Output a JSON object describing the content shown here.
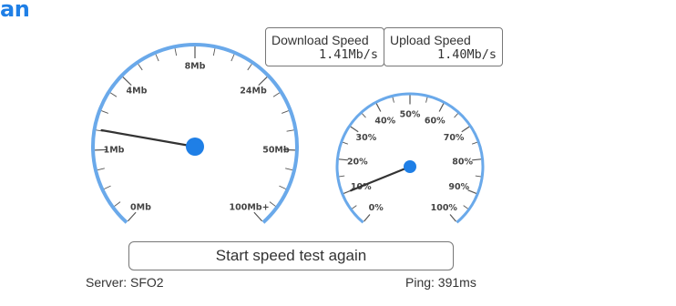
{
  "logo": {
    "text": "an",
    "color": "#1f7fe6"
  },
  "download": {
    "label": "Download Speed",
    "value": "1.41Mb/s"
  },
  "upload": {
    "label": "Upload Speed",
    "value": "1.40Mb/s"
  },
  "speed_gauge": {
    "labels": [
      "0Mb",
      "1Mb",
      "4Mb",
      "8Mb",
      "24Mb",
      "50Mb",
      "100Mb+"
    ],
    "needle_fraction": 0.21,
    "arc_color": "#6aa9ea",
    "hub_color": "#1f7fe6",
    "needle_color": "#333333"
  },
  "progress_gauge": {
    "labels": [
      "0%",
      "10%",
      "20%",
      "30%",
      "40%",
      "50%",
      "60%",
      "70%",
      "80%",
      "90%",
      "100%"
    ],
    "needle_fraction": 0.1,
    "arc_color": "#6aa9ea",
    "hub_color": "#1f7fe6",
    "needle_color": "#333333"
  },
  "actions": {
    "start_again_label": "Start speed test again"
  },
  "footer": {
    "server": "Server: SFO2",
    "ping": "Ping: 391ms"
  }
}
